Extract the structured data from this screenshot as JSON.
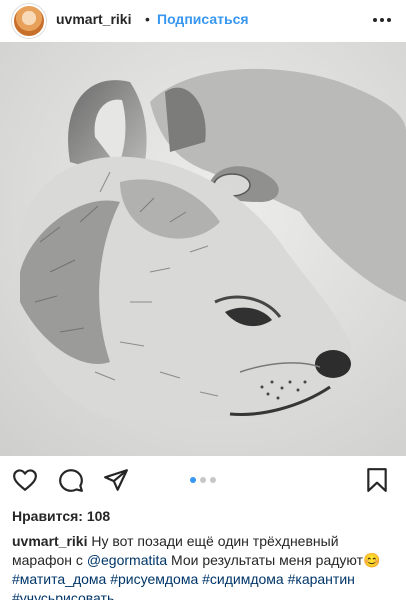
{
  "header": {
    "username": "uvmart_riki",
    "separator": "•",
    "follow_label": "Подписаться",
    "more_icon": "more-dots-icon"
  },
  "actions": {
    "icons": [
      "heart-icon",
      "comment-icon",
      "share-icon",
      "bookmark-icon"
    ],
    "carousel": {
      "count": 3,
      "active_index": 0
    }
  },
  "likes": {
    "label": "Нравится: 108"
  },
  "caption": {
    "username": "uvmart_riki",
    "text_1": " Ну вот позади ещё один трёхдневный марафон с ",
    "mention": "@egormatita",
    "text_2": " Мои результаты меня радуют",
    "emoji": "😊",
    "hashtags": [
      "#матита_дома",
      "#рисуемдома",
      "#сидимдома",
      "#карантин",
      "#учусьрисовать"
    ]
  },
  "colors": {
    "accent": "#3897f0",
    "link": "#003569",
    "text": "#262626"
  }
}
